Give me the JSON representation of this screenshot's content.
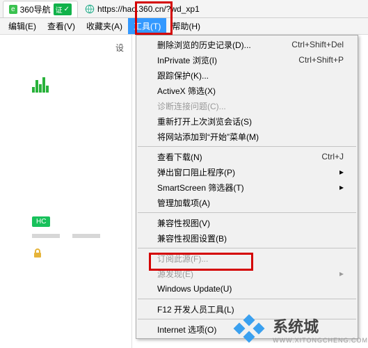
{
  "tab": {
    "title": "360导航",
    "cert": "证"
  },
  "url": "https://hao.360.cn/?wd_xp1",
  "menubar": {
    "edit": "编辑(E)",
    "view": "查看(V)",
    "favorites": "收藏夹(A)",
    "tools": "工具(T)",
    "help": "帮助(H)"
  },
  "dropdown": {
    "delete_history": {
      "label": "删除浏览的历史记录(D)...",
      "accel": "Ctrl+Shift+Del"
    },
    "inprivate": {
      "label": "InPrivate 浏览(I)",
      "accel": "Ctrl+Shift+P"
    },
    "tracking": {
      "label": "跟踪保护(K)...",
      "accel": ""
    },
    "activex": {
      "label": "ActiveX 筛选(X)",
      "accel": ""
    },
    "diagnose": {
      "label": "诊断连接问题(C)...",
      "accel": ""
    },
    "reopen": {
      "label": "重新打开上次浏览会话(S)",
      "accel": ""
    },
    "add_start": {
      "label": "将网站添加到“开始”菜单(M)",
      "accel": ""
    },
    "downloads": {
      "label": "查看下载(N)",
      "accel": "Ctrl+J"
    },
    "popup": {
      "label": "弹出窗口阻止程序(P)",
      "accel": ""
    },
    "smartscreen": {
      "label": "SmartScreen 筛选器(T)",
      "accel": ""
    },
    "addons": {
      "label": "管理加载项(A)",
      "accel": ""
    },
    "compat_view": {
      "label": "兼容性视图(V)",
      "accel": ""
    },
    "compat_settings": {
      "label": "兼容性视图设置(B)",
      "accel": ""
    },
    "subscribe": {
      "label": "订阅此源(F)...",
      "accel": ""
    },
    "feed_discover": {
      "label": "源发现(E)",
      "accel": ""
    },
    "win_update": {
      "label": "Windows Update(U)",
      "accel": ""
    },
    "f12": {
      "label": "F12 开发人员工具(L)",
      "accel": ""
    },
    "options": {
      "label": "Internet 选项(O)",
      "accel": ""
    }
  },
  "left": {
    "label": "设",
    "hc": "HC"
  },
  "watermark": {
    "brand": "系统城",
    "sub": "WWW.XITONGCHENG.COM"
  }
}
